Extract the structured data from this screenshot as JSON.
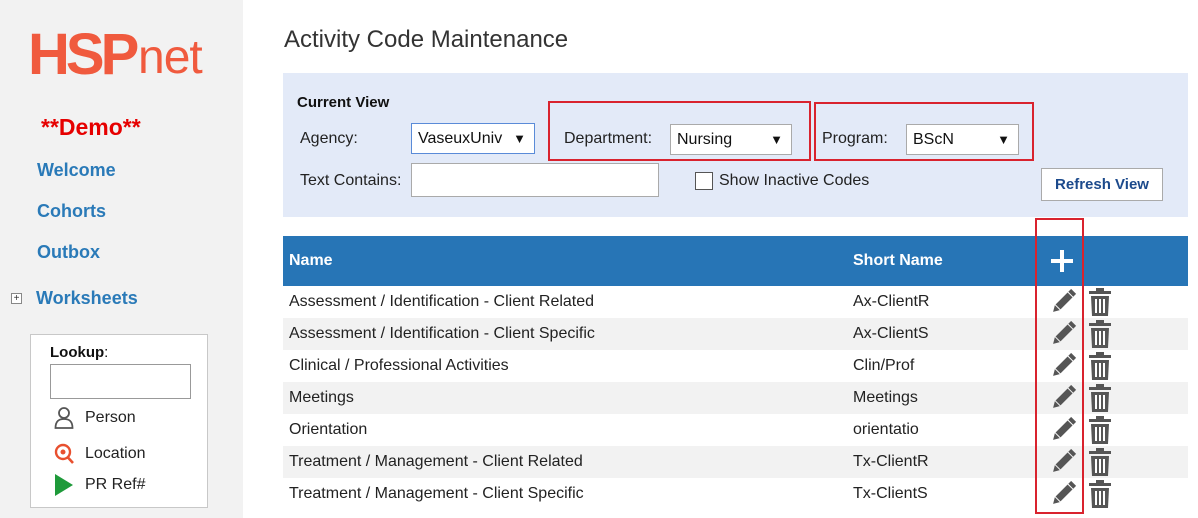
{
  "brand": {
    "logo_hsp": "HSP",
    "logo_net": "net",
    "demo_label": "**Demo**",
    "accent": "#f05a3e"
  },
  "sidebar": {
    "nav": [
      {
        "label": "Welcome"
      },
      {
        "label": "Cohorts"
      },
      {
        "label": "Outbox"
      },
      {
        "label": "Worksheets",
        "expand_icon": "plus-square-icon"
      }
    ],
    "lookup": {
      "label": "Lookup",
      "colon": ":",
      "input_value": "",
      "items": [
        {
          "label": "Person",
          "icon": "person-icon"
        },
        {
          "label": "Location",
          "icon": "location-pin-icon"
        },
        {
          "label": "PR Ref#",
          "icon": "play-icon"
        }
      ]
    }
  },
  "main": {
    "title": "Activity Code Maintenance",
    "filters": {
      "heading": "Current View",
      "agency_label": "Agency:",
      "agency_value": "VaseuxUniv",
      "department_label": "Department:",
      "department_value": "Nursing",
      "program_label": "Program:",
      "program_value": "BScN",
      "text_label": "Text Contains:",
      "text_value": "",
      "inactive_label": "Show Inactive Codes",
      "inactive_checked": false,
      "refresh_label": "Refresh View"
    },
    "table": {
      "header_color": "#2775b6",
      "columns": [
        "Name",
        "Short Name"
      ],
      "add_icon": "plus-icon",
      "rows": [
        {
          "name": "Assessment / Identification - Client Related",
          "short": "Ax-ClientR"
        },
        {
          "name": "Assessment / Identification - Client Specific",
          "short": "Ax-ClientS"
        },
        {
          "name": "Clinical / Professional Activities",
          "short": "Clin/Prof"
        },
        {
          "name": "Meetings",
          "short": "Meetings"
        },
        {
          "name": "Orientation",
          "short": "orientatio"
        },
        {
          "name": "Treatment / Management - Client Related",
          "short": "Tx-ClientR"
        },
        {
          "name": "Treatment / Management - Client Specific",
          "short": "Tx-ClientS"
        }
      ],
      "row_icons": [
        "pencil-edit-icon",
        "trash-icon"
      ]
    }
  },
  "highlight_color": "#d9232e"
}
